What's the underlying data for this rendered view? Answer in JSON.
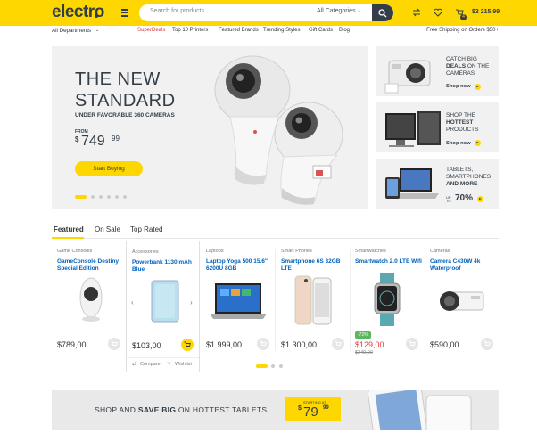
{
  "header": {
    "logo": "electro",
    "search_placeholder": "Search for products",
    "search_category": "All Categories",
    "cart_count": "4",
    "cart_total": "$3 215.99",
    "brand_color": "#fed700",
    "dark_color": "#333e48"
  },
  "nav": {
    "departments": "All Departments",
    "links": [
      "SuperDeals",
      "Top 10 Printers",
      "Featured Brands",
      "Trending Styles",
      "Gift Cards",
      "Blog"
    ],
    "shipping": "Free Shipping on Orders $50+"
  },
  "hero": {
    "line1": "THE NEW",
    "line2": "STANDARD",
    "subtitle": "UNDER FAVORABLE 360 CAMERAS",
    "from": "FROM",
    "currency": "$",
    "price": "749",
    "cents": "99",
    "button": "Start Buying"
  },
  "promos": [
    {
      "pre": "CATCH BIG",
      "bold": "DEALS",
      "post": " ON THE",
      "last": "CAMERAS",
      "link": "Shop now"
    },
    {
      "pre": "SHOP THE",
      "bold": "HOTTEST",
      "post": "",
      "last": "PRODUCTS",
      "link": "Shop now"
    },
    {
      "pre": "TABLETS,",
      "bold": "",
      "post": "SMARTPHONES",
      "last": "AND MORE",
      "link": "70%",
      "upto": "UP TO"
    }
  ],
  "tabs": [
    "Featured",
    "On Sale",
    "Top Rated"
  ],
  "products": [
    {
      "category": "Game Consoles",
      "name": "GameConsole Destiny Special Edition",
      "price": "$789,00",
      "icon": "console-image"
    },
    {
      "category": "Accessories",
      "name": "Powerbank 1130 mAh Blue",
      "price": "$103,00",
      "icon": "powerbank-image",
      "compare": "Compare",
      "wishlist": "Wishlist"
    },
    {
      "category": "Laptops",
      "name": "Laptop Yoga 500 15.6\" 6200U 8GB",
      "price": "$1 999,00",
      "icon": "laptop-image"
    },
    {
      "category": "Smart Phones",
      "name": "Smartphone 6S 32GB LTE",
      "price": "$1 300,00",
      "icon": "smartphone-image"
    },
    {
      "category": "Smartwatches",
      "name": "Smartwatch 2.0 LTE Wifi",
      "price": "$129,00",
      "old_price": "$249,00",
      "badge": "-72%",
      "icon": "smartwatch-image"
    },
    {
      "category": "Cameras",
      "name": "Camera C430W 4k Waterproof",
      "price": "$590,00",
      "icon": "camera-image"
    }
  ],
  "banner": {
    "pre": "SHOP AND ",
    "bold": "SAVE BIG",
    "post": " ON HOTTEST TABLETS",
    "starting": "STARTING AT",
    "currency": "$",
    "price": "79",
    "cents": "99"
  }
}
